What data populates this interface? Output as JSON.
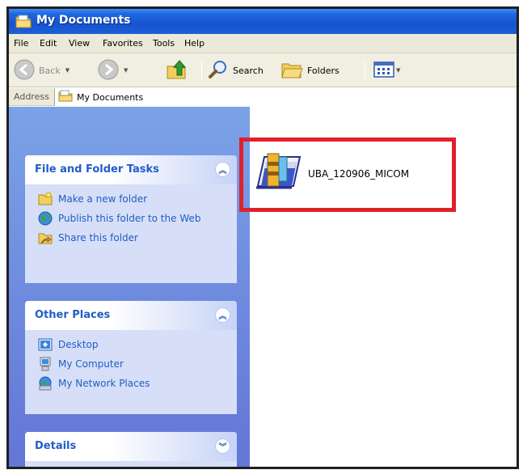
{
  "window": {
    "title": "My Documents",
    "title_icon": "folder-icon"
  },
  "menu": [
    "File",
    "Edit",
    "View",
    "Favorites",
    "Tools",
    "Help"
  ],
  "toolbar": {
    "back_label": "Back",
    "search_label": "Search",
    "folders_label": "Folders"
  },
  "address": {
    "label": "Address",
    "value": "My Documents"
  },
  "panels": {
    "file_folder_tasks": {
      "title": "File and Folder Tasks",
      "items": [
        "Make a new folder",
        "Publish this folder to the Web",
        "Share this folder"
      ]
    },
    "other_places": {
      "title": "Other Places",
      "items": [
        "Desktop",
        "My Computer",
        "My Network Places"
      ]
    },
    "details": {
      "title": "Details"
    }
  },
  "files": [
    {
      "name": "UBA_120906_MICOM",
      "icon": "installer-package-icon"
    }
  ],
  "colors": {
    "title_bar": "#1f5fd9",
    "task_link": "#215dc6",
    "highlight": "#e0202a",
    "left_pane": "#7ba2e7"
  }
}
